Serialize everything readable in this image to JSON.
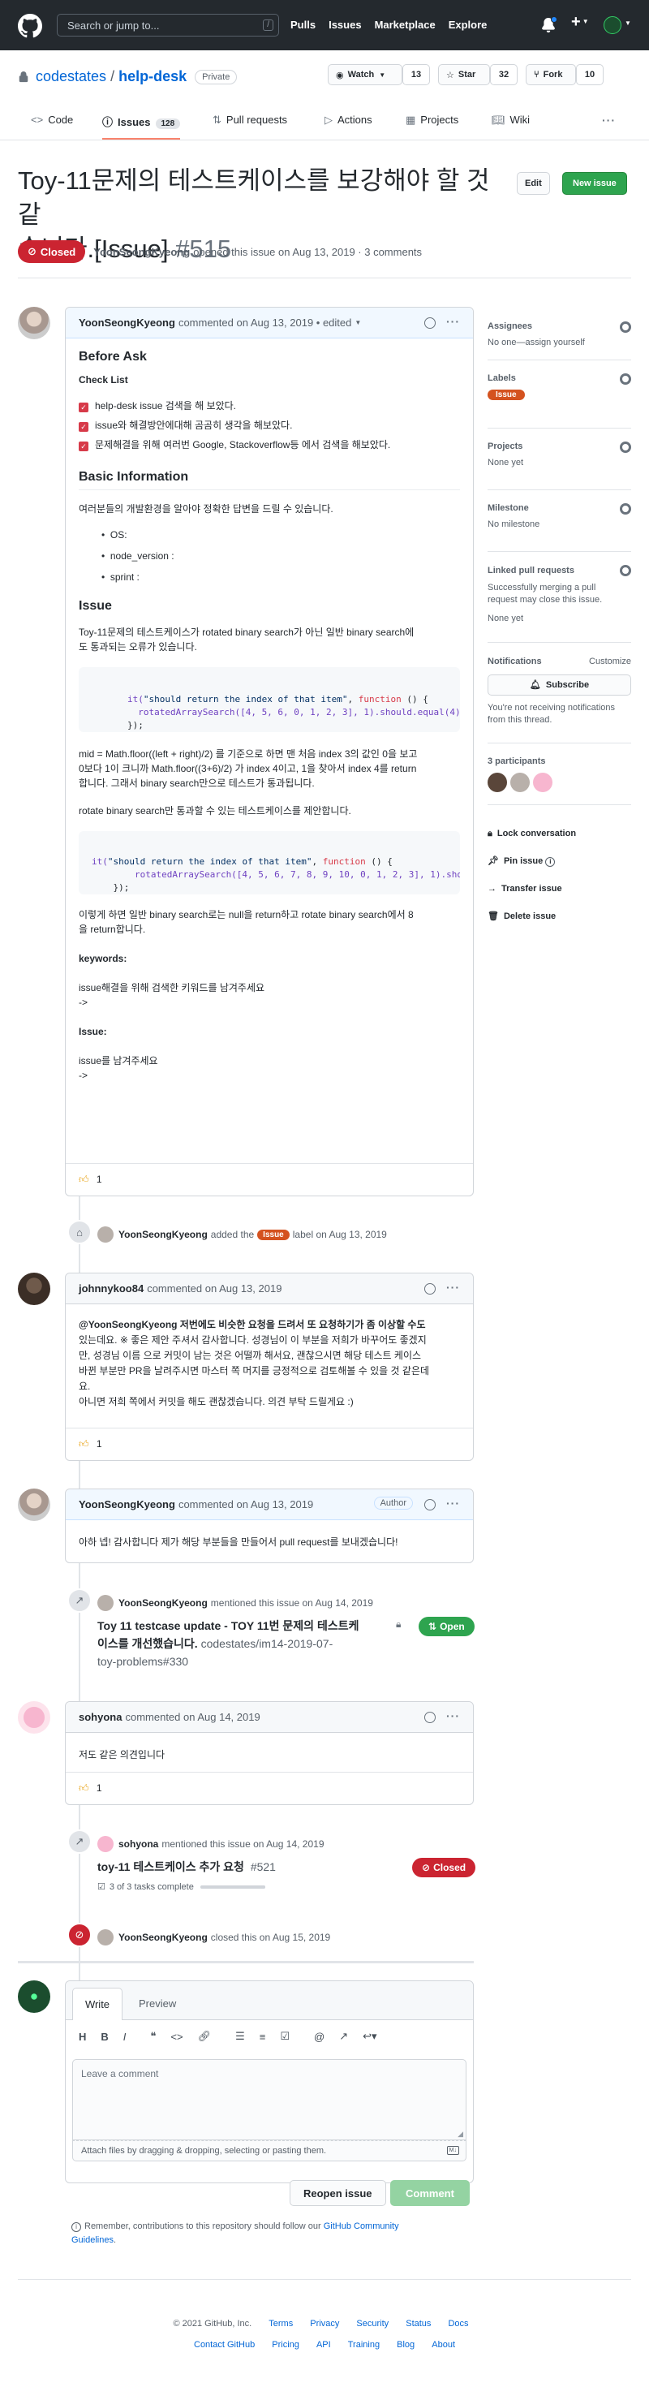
{
  "header": {
    "search_placeholder": "Search or jump to...",
    "search_key": "/",
    "nav": [
      "Pulls",
      "Issues",
      "Marketplace",
      "Explore"
    ],
    "plus": "+"
  },
  "repo": {
    "owner": "codestates",
    "sep": "/",
    "name": "help-desk",
    "visibility": "Private",
    "watch_label": "Watch",
    "watch_count": "13",
    "star_label": "Star",
    "star_count": "32",
    "fork_label": "Fork",
    "fork_count": "10"
  },
  "tabs": [
    {
      "label": "Code",
      "count": ""
    },
    {
      "label": "Issues",
      "count": "128"
    },
    {
      "label": "Pull requests",
      "count": ""
    },
    {
      "label": "Actions",
      "count": ""
    },
    {
      "label": "Projects",
      "count": ""
    },
    {
      "label": "Wiki",
      "count": ""
    }
  ],
  "issue": {
    "title_line1": "Toy-11문제의 테스트케이스를 보강해야 할 것 같",
    "title_line2": "습니다.[Issue]",
    "number": "#515",
    "edit_label": "Edit",
    "new_issue_label": "New issue",
    "state": "Closed",
    "author": "YoonSeongKyeong",
    "meta": "opened this issue on Aug 13, 2019 · 3 comments"
  },
  "first_comment": {
    "author": "YoonSeongKyeong",
    "meta": "commented on Aug 13, 2019 • edited",
    "before_ask": "Before Ask",
    "check_list": "Check List",
    "checks": [
      "help-desk issue 검색을 해 보았다.",
      "issue와 해결방안에대해 곰곰히 생각을 해보았다.",
      "문제해결을 위해 여러번 Google, Stackoverflow등 에서 검색을 해보았다."
    ],
    "basic_info": "Basic Information",
    "basic_info_desc": "여러분들의 개발환경을 알아야 정확한 답변을 드릴 수 있습니다.",
    "env": [
      "OS:",
      "node_version :",
      "sprint :"
    ],
    "issue_h": "Issue",
    "issue_p1_l1": "Toy-11문제의 테스트케이스가 rotated binary search가 아닌 일반 binary search에",
    "issue_p1_l2": "도 통과되는 오류가 있습니다.",
    "code1_l1a": "it(",
    "code1_l1b": "\"should return the index of that item\"",
    "code1_l1c": ", ",
    "code1_l1d": "function",
    "code1_l1e": " () {",
    "code1_l2": "  rotatedArraySearch([4, 5, 6, 0, 1, 2, 3], 1).should.equal(4);",
    "code1_l3": "});",
    "p2_l1": "mid = Math.floor((left + right)/2) 를 기준으로 하면 맨 처음 index 3의 값인 0을 보고",
    "p2_l2": "0보다 1이 크니까 Math.floor((3+6)/2) 가 index 4이고, 1을 찾아서 index 4를 return",
    "p2_l3": "합니다. 그래서 binary search만으로 테스트가 통과됩니다.",
    "p3": "rotate binary search만 통과할 수 있는 테스트케이스를 제안합니다.",
    "code2_l2": "        rotatedArraySearch([4, 5, 6, 7, 8, 9, 10, 0, 1, 2, 3], 1).should.equal(8);",
    "code2_l3": "    });",
    "p4_l1": "이렇게 하면 일반 binary search로는 null을 return하고 rotate binary search에서 8",
    "p4_l2": "을 return합니다.",
    "keywords_h": "keywords:",
    "keywords_p": "issue해결을 위해 검색한 키워드를 남겨주세요",
    "arrow": "->",
    "issue2_h": "Issue:",
    "issue2_p": "issue를 남겨주세요",
    "reaction_count": "1"
  },
  "label_event": {
    "author": "YoonSeongKyeong",
    "text_before": "added the",
    "label": "Issue",
    "text_after": "label on Aug 13, 2019"
  },
  "comment2": {
    "author": "johnnykoo84",
    "meta": "commented on Aug 13, 2019",
    "l1": "@YoonSeongKyeong 저번에도 비슷한 요청을 드려서 또 요청하기가 좀 이상할 수도",
    "l2": "있는데요. ※ 좋은 제안 주셔서 감사합니다. 성경님이 이 부분을 저희가 바꾸어도 좋겠지",
    "l3": "만, 성경님 이름 으로 커밋이 남는 것은 어떨까 해서요, 괜찮으시면 해당 테스트 케이스",
    "l4": "바뀐 부분만 PR을 날려주시면 마스터 쪽 머지를 긍정적으로 검토해볼 수 있을 것 같은데",
    "l5": "요.",
    "l6": "아니면 저희 쪽에서 커밋을 해도 괜찮겠습니다. 의견 부탁 드릴게요 :)",
    "reaction_count": "1"
  },
  "comment3": {
    "author": "YoonSeongKyeong",
    "meta": "commented on Aug 13, 2019",
    "role": "Author",
    "body": "아하 넵! 감사합니다 제가 해당 부분들을 만들어서 pull request를 보내겠습니다!"
  },
  "mention1": {
    "author": "YoonSeongKyeong",
    "meta": "mentioned this issue on Aug 14, 2019",
    "title_l1": "Toy 11 testcase update - TOY 11번 문제의 테스트케",
    "title_l2": "이스를 개선했습니다.",
    "repo_ref_l2": "codestates/im14-2019-07-",
    "repo_ref_l3": "toy-problems#330",
    "state": "Open"
  },
  "comment4": {
    "author": "sohyona",
    "meta": "commented on Aug 14, 2019",
    "body": "저도 같은 의견입니다",
    "reaction_count": "1"
  },
  "mention2": {
    "author": "sohyona",
    "meta": "mentioned this issue on Aug 14, 2019",
    "title": "toy-11 테스트케이스 추가 요청",
    "number": "#521",
    "tasks": "3 of 3 tasks complete",
    "tasks_progress": 1.0,
    "state": "Closed"
  },
  "closed_event": {
    "author": "YoonSeongKyeong",
    "meta": "closed this on Aug 15, 2019"
  },
  "composer": {
    "tab_write": "Write",
    "tab_preview": "Preview",
    "toolbar": [
      "H",
      "B",
      "I"
    ],
    "placeholder": "Leave a comment",
    "attach": "Attach files by dragging & dropping, selecting or pasting them.",
    "reopen_label": "Reopen issue",
    "comment_label": "Comment",
    "notice_before": "Remember, contributions to this repository should follow our ",
    "notice_link": "GitHub Community",
    "notice_link2": "Guidelines",
    "notice_after": "."
  },
  "sidebar": {
    "assignees_h": "Assignees",
    "assignees_v": "No one—assign yourself",
    "labels_h": "Labels",
    "label_value": "Issue",
    "projects_h": "Projects",
    "projects_v": "None yet",
    "milestone_h": "Milestone",
    "milestone_v": "No milestone",
    "linked_h": "Linked pull requests",
    "linked_d1": "Successfully merging a pull",
    "linked_d2": "request may close this issue.",
    "linked_v": "None yet",
    "notif_h": "Notifications",
    "customize": "Customize",
    "subscribe": "Subscribe",
    "notif_d1": "You're not receiving notifications",
    "notif_d2": "from this thread.",
    "participants_h": "3 participants",
    "lock": "Lock conversation",
    "pin": "Pin issue",
    "transfer": "Transfer issue",
    "delete": "Delete issue"
  },
  "footer": {
    "copyright": "© 2021 GitHub, Inc.",
    "row1": [
      "Terms",
      "Privacy",
      "Security",
      "Status",
      "Docs"
    ],
    "row2": [
      "Contact GitHub",
      "Pricing",
      "API",
      "Training",
      "Blog",
      "About"
    ]
  },
  "colors": {
    "header_bg": "#24292e",
    "closed_red": "#cb2431",
    "open_green": "#2ea44f",
    "link_blue": "#0366d6",
    "label_orange": "#d4521f"
  }
}
